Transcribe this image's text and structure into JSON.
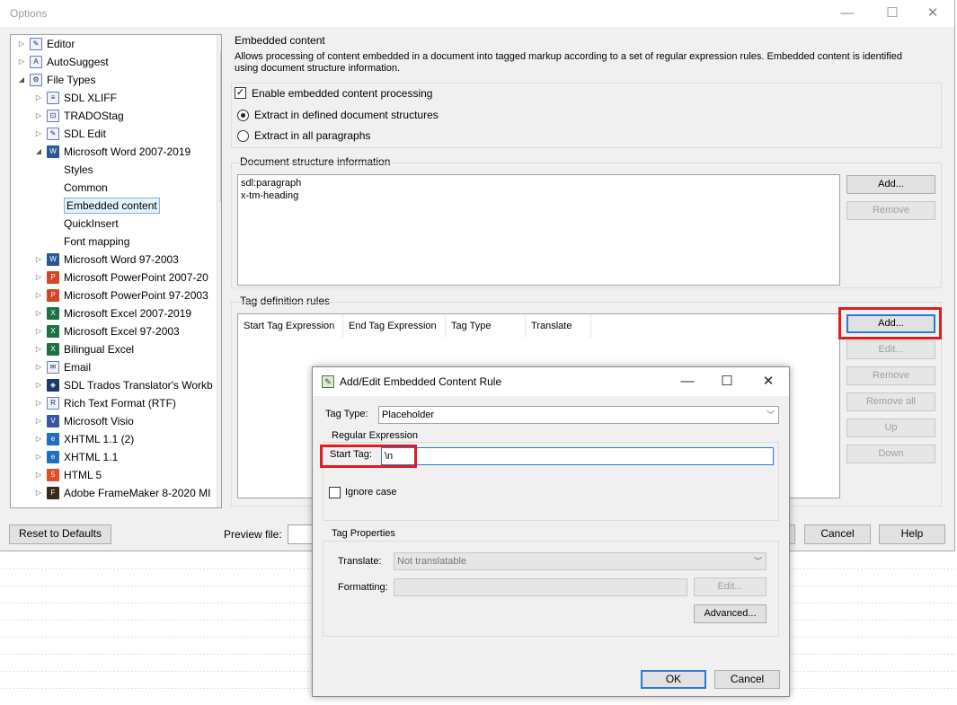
{
  "options_window": {
    "title": "Options",
    "controls": {
      "minimize": "—",
      "maximize": "☐",
      "close": "✕"
    }
  },
  "tree": {
    "items": [
      {
        "label": "Editor",
        "icon": "pencil-icon",
        "expanded": false
      },
      {
        "label": "AutoSuggest",
        "icon": "autosuggest-icon",
        "expanded": false
      },
      {
        "label": "File Types",
        "icon": "gear-icon",
        "expanded": true
      },
      {
        "label": "SDL XLIFF",
        "icon": "xliff-icon",
        "expanded": false
      },
      {
        "label": "TRADOStag",
        "icon": "tradostag-icon",
        "expanded": false
      },
      {
        "label": "SDL Edit",
        "icon": "sdl-edit-icon",
        "expanded": false
      },
      {
        "label": "Microsoft Word 2007-2019",
        "icon": "word-icon",
        "expanded": true
      },
      {
        "label": "Styles",
        "icon": "",
        "expanded": null
      },
      {
        "label": "Common",
        "icon": "",
        "expanded": null
      },
      {
        "label": "Embedded content",
        "icon": "",
        "expanded": null,
        "selected": true
      },
      {
        "label": "QuickInsert",
        "icon": "",
        "expanded": null
      },
      {
        "label": "Font mapping",
        "icon": "",
        "expanded": null
      },
      {
        "label": "Microsoft Word 97-2003",
        "icon": "word-icon",
        "expanded": false
      },
      {
        "label": "Microsoft PowerPoint 2007-20",
        "icon": "powerpoint-icon",
        "expanded": false
      },
      {
        "label": "Microsoft PowerPoint 97-2003",
        "icon": "powerpoint-icon",
        "expanded": false
      },
      {
        "label": "Microsoft Excel 2007-2019",
        "icon": "excel-icon",
        "expanded": false
      },
      {
        "label": "Microsoft Excel 97-2003",
        "icon": "excel-icon",
        "expanded": false
      },
      {
        "label": "Bilingual Excel",
        "icon": "excel-icon",
        "expanded": false
      },
      {
        "label": "Email",
        "icon": "email-icon",
        "expanded": false
      },
      {
        "label": "SDL Trados Translator's Workb",
        "icon": "trados-icon",
        "expanded": false
      },
      {
        "label": "Rich Text Format (RTF)",
        "icon": "rtf-icon",
        "expanded": false
      },
      {
        "label": "Microsoft Visio",
        "icon": "visio-icon",
        "expanded": false
      },
      {
        "label": "XHTML 1.1 (2)",
        "icon": "ie-icon",
        "expanded": false
      },
      {
        "label": "XHTML 1.1",
        "icon": "ie-icon",
        "expanded": false
      },
      {
        "label": "HTML 5",
        "icon": "html5-icon",
        "expanded": false
      },
      {
        "label": "Adobe FrameMaker 8-2020 MI",
        "icon": "framemaker-icon",
        "expanded": false
      }
    ]
  },
  "embedded": {
    "heading": "Embedded content",
    "description": "Allows processing of content embedded in a document into tagged markup according to a set of regular expression rules. Embedded content is identified using document structure information.",
    "enable_label": "Enable embedded content processing",
    "enable_checked": true,
    "radio_defined": "Extract in defined document structures",
    "radio_all": "Extract in all paragraphs",
    "selected_option": "defined"
  },
  "doc_structure": {
    "heading": "Document structure information",
    "lines": [
      "sdl:paragraph",
      "x-tm-heading"
    ],
    "add_label": "Add...",
    "remove_label": "Remove"
  },
  "tag_rules": {
    "heading": "Tag definition rules",
    "columns": [
      "Start Tag Expression",
      "End Tag Expression",
      "Tag Type",
      "Translate"
    ],
    "buttons": {
      "add": "Add...",
      "edit": "Edit...",
      "remove": "Remove",
      "remove_all": "Remove all",
      "up": "Up",
      "down": "Down"
    }
  },
  "footer": {
    "reset_label": "Reset to Defaults",
    "preview_label": "Preview file:",
    "cancel_label": "Cancel",
    "help_label": "Help"
  },
  "dialog": {
    "title": "Add/Edit Embedded Content Rule",
    "controls": {
      "minimize": "—",
      "maximize": "☐",
      "close": "✕"
    },
    "tag_type_label": "Tag Type:",
    "tag_type_value": "Placeholder",
    "regex_heading": "Regular Expression",
    "start_tag_label": "Start Tag:",
    "start_tag_value": "\\n",
    "ignore_case_label": "Ignore case",
    "ignore_case_checked": false,
    "props_heading": "Tag Properties",
    "translate_label": "Translate:",
    "translate_value": "Not translatable",
    "formatting_label": "Formatting:",
    "formatting_value": "",
    "edit_label": "Edit...",
    "advanced_label": "Advanced...",
    "ok_label": "OK",
    "cancel_label": "Cancel"
  },
  "highlight_color": "#e11b22"
}
